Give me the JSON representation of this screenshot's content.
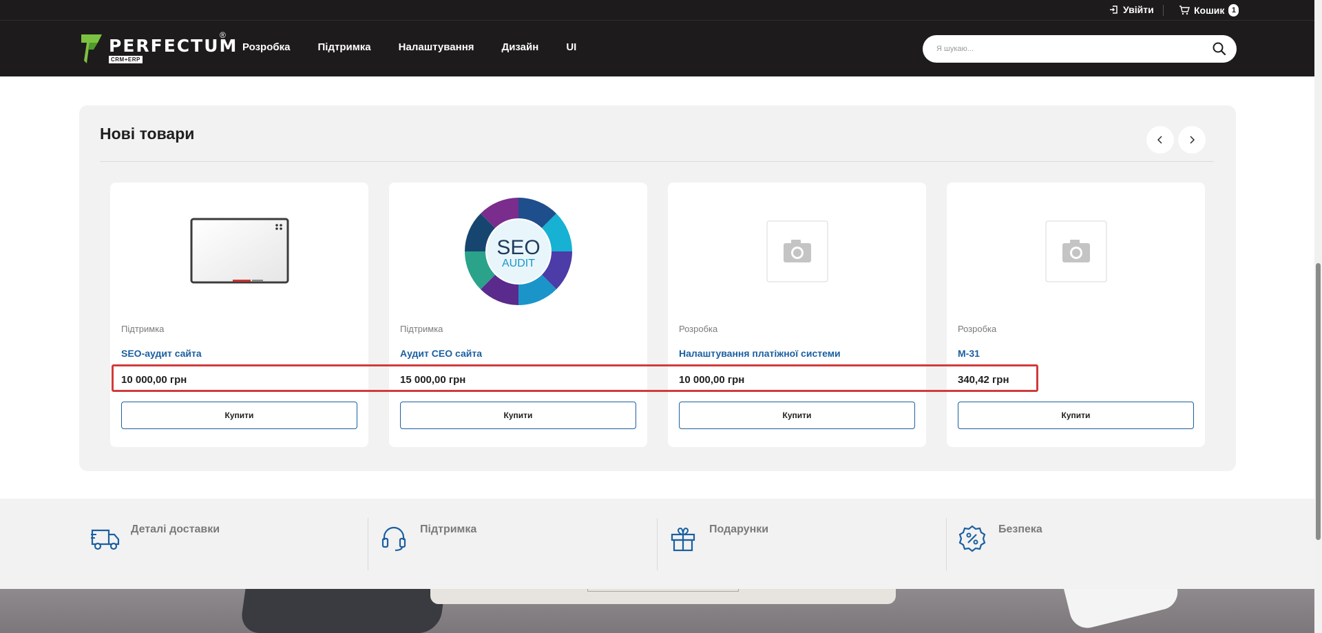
{
  "topbar": {
    "login_label": "Увійти",
    "cart_label": "Кошик",
    "cart_count": "1"
  },
  "header": {
    "brand": "PERFECTUM",
    "brand_sub": "CRM+ERP",
    "reg_mark": "®",
    "nav": [
      "Розробка",
      "Підтримка",
      "Налаштування",
      "Дизайн",
      "UI"
    ],
    "search_placeholder": "Я шукаю..."
  },
  "section": {
    "title": "Нові товари",
    "products": [
      {
        "category": "Підтримка",
        "title": "SEO-аудит сайта",
        "price": "10 000,00 грн",
        "buy_label": "Купити",
        "image": "whiteboard"
      },
      {
        "category": "Підтримка",
        "title": "Аудит СЕО сайта",
        "price": "15 000,00 грн",
        "buy_label": "Купити",
        "image": "seo-audit"
      },
      {
        "category": "Розробка",
        "title": "Налаштування платіжної системи",
        "price": "10 000,00 грн",
        "buy_label": "Купити",
        "image": "placeholder-camera"
      },
      {
        "category": "Розробка",
        "title": "М-31",
        "price": "340,42 грн",
        "buy_label": "Купити",
        "image": "placeholder-camera"
      }
    ],
    "seo_badge": {
      "line1": "SEO",
      "line2": "AUDIT"
    }
  },
  "features": [
    {
      "label": "Деталі доставки",
      "icon": "truck-icon"
    },
    {
      "label": "Підтримка",
      "icon": "headset-icon"
    },
    {
      "label": "Подарунки",
      "icon": "gift-icon"
    },
    {
      "label": "Безпека",
      "icon": "percent-badge-icon"
    }
  ],
  "colors": {
    "header_bg": "#1d1b1c",
    "link_blue": "#1a5fa0",
    "highlight_red": "#d23a3a",
    "section_bg": "#f2f2f2"
  }
}
